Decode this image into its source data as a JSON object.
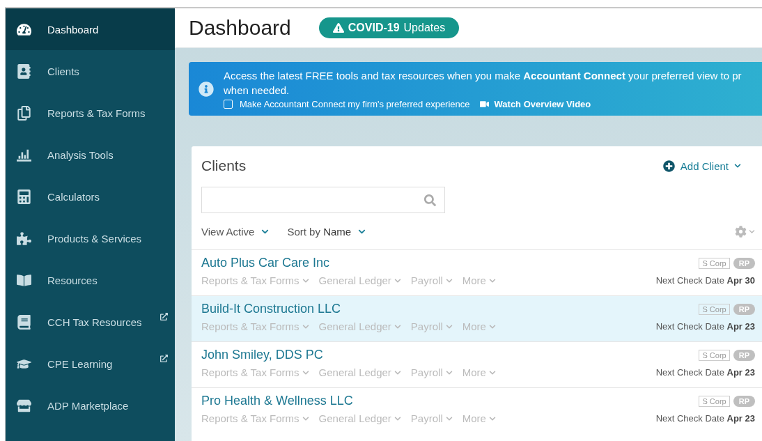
{
  "sidebar": {
    "items": [
      {
        "label": "Dashboard",
        "selected": true,
        "external": false
      },
      {
        "label": "Clients",
        "selected": false,
        "external": false
      },
      {
        "label": "Reports & Tax Forms",
        "selected": false,
        "external": false
      },
      {
        "label": "Analysis Tools",
        "selected": false,
        "external": false
      },
      {
        "label": "Calculators",
        "selected": false,
        "external": false
      },
      {
        "label": "Products & Services",
        "selected": false,
        "external": false
      },
      {
        "label": "Resources",
        "selected": false,
        "external": false
      },
      {
        "label": "CCH Tax Resources",
        "selected": false,
        "external": true
      },
      {
        "label": "CPE Learning",
        "selected": false,
        "external": true
      },
      {
        "label": "ADP Marketplace",
        "selected": false,
        "external": false
      }
    ]
  },
  "header": {
    "title": "Dashboard",
    "badge": {
      "bold": "COVID-19",
      "text": "Updates"
    }
  },
  "banner": {
    "lines": [
      "Access the latest FREE tools and tax resources when you make **Accountant Connect** your preferred view to pr",
      "when needed."
    ],
    "checkbox": {
      "label": "Make Accountant Connect my firm's preferred experience",
      "checked": false
    },
    "video_link": "Watch Overview Video"
  },
  "clients": {
    "title": "Clients",
    "add_button": "Add Client",
    "filters": [
      "View Active",
      "Sort by **Name**"
    ],
    "rows": [
      {
        "name": "Auto Plus Car Care Inc",
        "selected": false,
        "links": [
          "Reports & Tax Forms",
          "General Ledger",
          "Payroll",
          "More"
        ],
        "type": "S Corp",
        "tag": "RP",
        "next_check_label": "Next Check Date",
        "next_check_date": "Apr 30"
      },
      {
        "name": "Build-It Construction LLC",
        "selected": true,
        "links": [
          "Reports & Tax Forms",
          "General Ledger",
          "Payroll",
          "More"
        ],
        "type": "S Corp",
        "tag": "RP",
        "next_check_label": "Next Check Date",
        "next_check_date": "Apr 23"
      },
      {
        "name": "John Smiley, DDS PC",
        "selected": false,
        "links": [
          "Reports & Tax Forms",
          "General Ledger",
          "Payroll",
          "More"
        ],
        "type": "S Corp",
        "tag": "RP",
        "next_check_label": "Next Check Date",
        "next_check_date": "Apr 23"
      },
      {
        "name": "Pro Health & Wellness LLC",
        "selected": false,
        "links": [
          "Reports & Tax Forms",
          "General Ledger",
          "Payroll",
          "More"
        ],
        "type": "S Corp",
        "tag": "RP",
        "next_check_label": "Next Check Date",
        "next_check_date": "Apr 23"
      }
    ]
  }
}
